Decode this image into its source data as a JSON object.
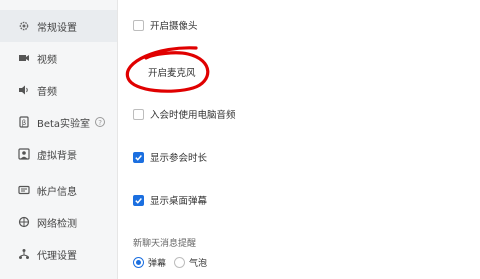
{
  "sidebar": {
    "items": [
      {
        "label": "常规设置",
        "icon": "gear-icon"
      },
      {
        "label": "视频",
        "icon": "video-camera-icon"
      },
      {
        "label": "音频",
        "icon": "speaker-icon"
      },
      {
        "label": "Beta实验室",
        "icon": "beta-flask-icon",
        "help": "?"
      },
      {
        "label": "虚拟背景",
        "icon": "person-background-icon"
      },
      {
        "label": "帐户信息",
        "icon": "account-card-icon"
      },
      {
        "label": "网络检测",
        "icon": "network-icon"
      },
      {
        "label": "代理设置",
        "icon": "proxy-icon"
      }
    ],
    "active_index": 0
  },
  "settings": {
    "camera": {
      "label": "开启摄像头",
      "checked": false
    },
    "microphone": {
      "label": "开启麦克风"
    },
    "computer_audio": {
      "label": "入会时使用电脑音频",
      "checked": false
    },
    "show_duration": {
      "label": "显示参会时长",
      "checked": true
    },
    "desktop_barrage": {
      "label": "显示桌面弹幕",
      "checked": true
    }
  },
  "chat_notice": {
    "title": "新聊天消息提醒",
    "options": [
      {
        "label": "弹幕",
        "selected": true
      },
      {
        "label": "气泡",
        "selected": false
      }
    ]
  },
  "colors": {
    "accent": "#1b6fe0",
    "annotation": "#e00000"
  }
}
